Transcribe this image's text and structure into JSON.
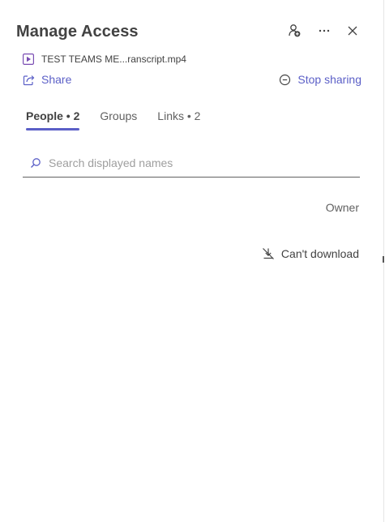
{
  "header": {
    "title": "Manage Access",
    "icons": [
      "add-people-icon",
      "more-options-icon",
      "close-icon"
    ]
  },
  "file": {
    "name": "TEST TEAMS ME...ranscript.mp4",
    "icon": "video-file-icon",
    "icon_color": "#7a4db3"
  },
  "actions": {
    "share_label": "Share",
    "stop_sharing_label": "Stop sharing",
    "link_color": "#5b5fc7"
  },
  "tabs": [
    {
      "label": "People • 2",
      "active": true
    },
    {
      "label": "Groups",
      "active": false
    },
    {
      "label": "Links • 2",
      "active": false
    }
  ],
  "search": {
    "placeholder": "Search displayed names",
    "value": ""
  },
  "people": [
    {
      "role": "Owner"
    },
    {
      "role": "Can't download",
      "icon": "no-download-icon"
    }
  ],
  "colors": {
    "accent": "#5b5fc7",
    "text": "#424242"
  }
}
